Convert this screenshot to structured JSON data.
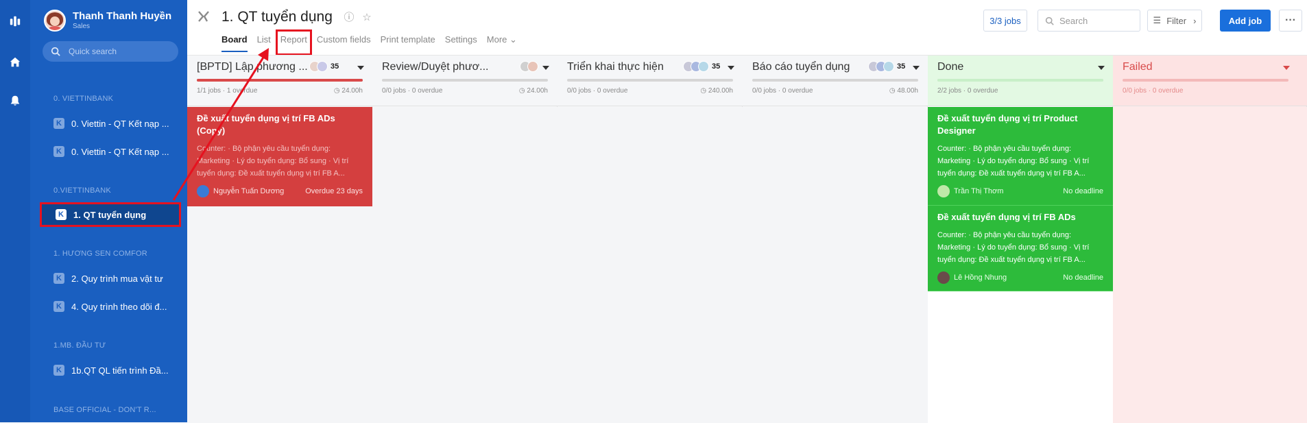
{
  "user": {
    "name": "Thanh Thanh Huyền",
    "role": "Sales"
  },
  "sidebar": {
    "search_placeholder": "Quick search",
    "groups": [
      {
        "label": "0. VIETTINBANK",
        "items": [
          "0. Viettin - QT Kết nạp ...",
          "0. Viettin - QT Kết nạp ..."
        ]
      },
      {
        "label": "0.VIETTINBANK",
        "items": [
          "1. QT tuyển dụng"
        ]
      },
      {
        "label": "1. HƯƠNG SEN COMFOR",
        "items": [
          "2. Quy trình mua vật tư",
          "4. Quy trình theo dõi đ..."
        ]
      },
      {
        "label": "1.MB. ĐẦU TƯ",
        "items": [
          "1b.QT QL tiến trình Đầ..."
        ]
      },
      {
        "label": "BASE OFFICIAL - DON'T R..."
      }
    ]
  },
  "header": {
    "title": "1. QT tuyển dụng",
    "tabs": [
      "Board",
      "List",
      "Report",
      "Custom fields",
      "Print template",
      "Settings",
      "More"
    ],
    "jobs": "3/3 jobs",
    "search_placeholder": "Search",
    "filter": "Filter",
    "add_job": "Add job",
    "more": "···"
  },
  "colors": {
    "accent": "#1a6fdc",
    "sidebar": "#1a5fc0",
    "red": "#d43f3f",
    "green": "#2dbb3b",
    "highlight": "#e6121f"
  },
  "columns": [
    {
      "title": "[BPTD] Lập phương ...",
      "count": "35",
      "meta": "1/1 jobs · 1 overdue",
      "time": "24.00h",
      "bar_color": "#d94a4a",
      "bar_fill": 1
    },
    {
      "title": "Review/Duyệt phươ...",
      "count": "",
      "meta": "0/0 jobs · 0 overdue",
      "time": "24.00h",
      "bar_color": "#d6d6d6",
      "bar_fill": 0
    },
    {
      "title": "Triển khai thực hiện",
      "count": "35",
      "meta": "0/0 jobs · 0 overdue",
      "time": "240.00h",
      "bar_color": "#d6d6d6",
      "bar_fill": 0
    },
    {
      "title": "Báo cáo tuyển dụng",
      "count": "35",
      "meta": "0/0 jobs · 0 overdue",
      "time": "48.00h",
      "bar_color": "#d6d6d6",
      "bar_fill": 0
    },
    {
      "title": "Done",
      "count": "",
      "meta": "2/2 jobs · 0 overdue",
      "time": "",
      "bar_color": "#2dbb3b",
      "bar_fill": 1
    },
    {
      "title": "Failed",
      "count": "",
      "meta": "0/0 jobs · 0 overdue",
      "time": "",
      "bar_color": "#e07070",
      "bar_fill": 0
    }
  ],
  "cards": {
    "red": {
      "title": "Đề xuất tuyển dụng vị trí FB ADs (Copy)",
      "desc": "Counter: · Bộ phận yêu cầu tuyển dụng: Marketing · Lý do tuyển dụng: Bổ sung · Vị trí tuyển dụng: Đề xuất tuyển dụng vị trí FB A...",
      "user": "Nguyễn Tuấn Dương",
      "due": "Overdue 23 days"
    },
    "green1": {
      "title": "Đề xuất tuyển dụng vị trí Product Designer",
      "desc": "Counter: · Bộ phận yêu cầu tuyển dụng: Marketing · Lý do tuyển dụng: Bổ sung · Vị trí tuyển dụng: Đề xuất tuyển dụng vị trí FB A...",
      "user": "Trần Thị Thơm",
      "due": "No deadline"
    },
    "green2": {
      "title": "Đề xuất tuyển dụng vị trí FB ADs",
      "desc": "Counter: · Bộ phận yêu cầu tuyển dụng: Marketing · Lý do tuyển dụng: Bổ sung · Vị trí tuyển dụng: Đề xuất tuyển dụng vị trí FB A...",
      "user": "Lê Hồng Nhung",
      "due": "No deadline"
    }
  }
}
